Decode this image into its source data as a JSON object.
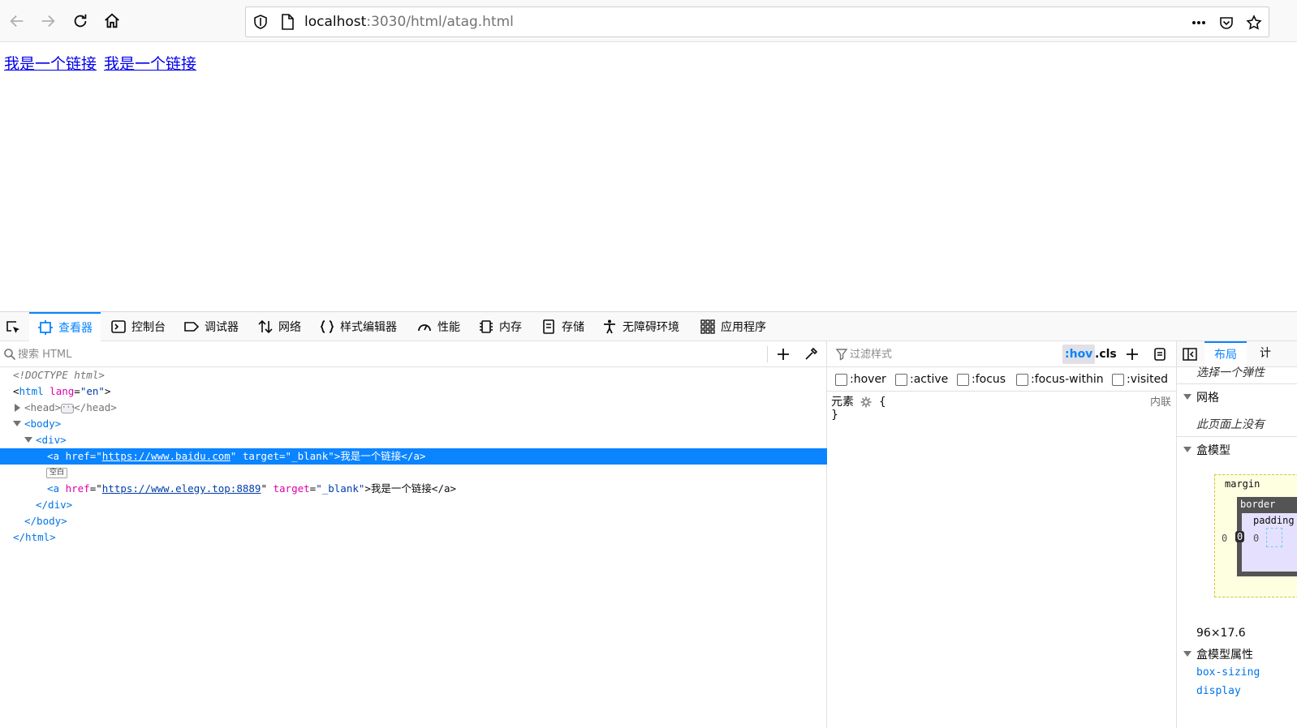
{
  "browser": {
    "url_host": "localhost",
    "url_path": ":3030/html/atag.html"
  },
  "page": {
    "links": [
      "我是一个链接",
      "我是一个链接"
    ]
  },
  "devtools": {
    "tabs": [
      {
        "label": "查看器",
        "icon": "inspector-icon"
      },
      {
        "label": "控制台",
        "icon": "console-icon"
      },
      {
        "label": "调试器",
        "icon": "debugger-icon"
      },
      {
        "label": "网络",
        "icon": "network-icon"
      },
      {
        "label": "样式编辑器",
        "icon": "style-editor-icon"
      },
      {
        "label": "性能",
        "icon": "performance-icon"
      },
      {
        "label": "内存",
        "icon": "memory-icon"
      },
      {
        "label": "存储",
        "icon": "storage-icon"
      },
      {
        "label": "无障碍环境",
        "icon": "accessibility-icon"
      },
      {
        "label": "应用程序",
        "icon": "application-icon"
      }
    ],
    "html_search_placeholder": "搜索 HTML",
    "tree": {
      "doctype": "<!DOCTYPE html>",
      "html_tag": "html",
      "lang_attr": "lang",
      "lang_val": "\"en\"",
      "head_open": "<head>",
      "head_close": "</head>",
      "body_open": "<body>",
      "div_open": "<div>",
      "a1_open": "<a ",
      "href_attr": "href",
      "eq_quote": "=\"",
      "a1_href": "https://www.baidu.com",
      "close_quote": "\"",
      "target_attr": "target",
      "target_val": "\"_blank\"",
      "a_text": ">我是一个链接</a>",
      "whitespace_badge": "空白",
      "a2_href": "https://www.elegy.top:8889",
      "div_close": "</div>",
      "body_close": "</body>",
      "html_close": "</html>"
    },
    "rules": {
      "filter_placeholder": "过滤样式",
      "hov": ":hov",
      "cls": ".cls",
      "pseudo": [
        ":hover",
        ":active",
        ":focus",
        ":focus-within",
        ":visited"
      ],
      "element_label": "元素",
      "open_brace": "{",
      "close_brace": "}",
      "source": "内联"
    },
    "layout": {
      "tab_layout": "布局",
      "tab_computed": "计",
      "flex_hint": "选择一个弹性",
      "grid_section": "网格",
      "grid_note": "此页面上没有",
      "box_model_section": "盒模型",
      "margin_label": "margin",
      "border_label": "border",
      "padding_label": "padding",
      "margin_left": "0",
      "border_left": "0",
      "padding_left": "0",
      "dimensions": "96×17.6",
      "box_props_section": "盒模型属性",
      "prop1": "box-sizing",
      "prop2": "display"
    }
  },
  "colors": {
    "accent": "#0a84ff",
    "link": "#0000ee",
    "selected_row": "#0a84ff"
  }
}
